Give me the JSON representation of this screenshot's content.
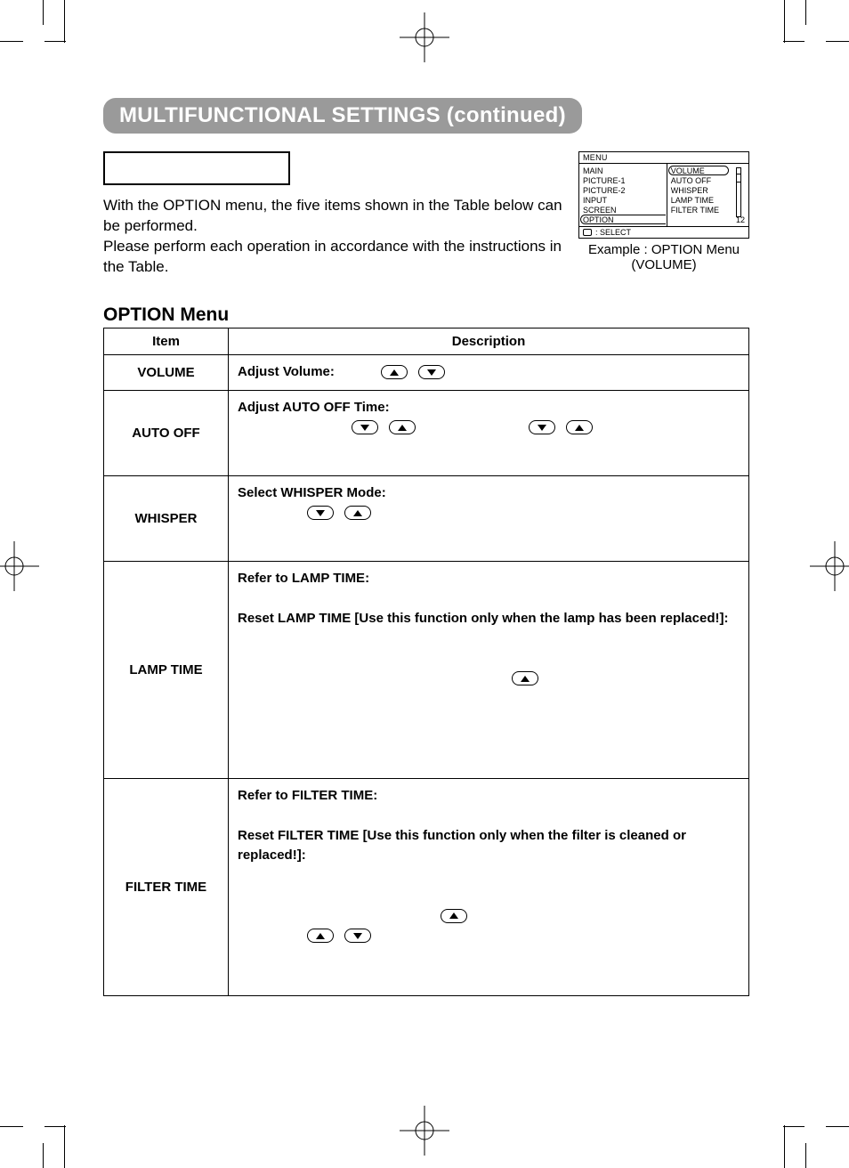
{
  "header": {
    "title": "MULTIFUNCTIONAL SETTINGS (continued)"
  },
  "intro": {
    "line1": "With the OPTION menu, the five items shown in the Table below can be performed.",
    "line2": "Please perform each operation in accordance with the instructions in the Table."
  },
  "osd": {
    "title": "MENU",
    "col1": [
      "MAIN",
      "PICTURE-1",
      "PICTURE-2",
      "INPUT",
      "SCREEN",
      "OPTION"
    ],
    "col2": [
      "VOLUME",
      "AUTO OFF",
      "WHISPER",
      "LAMP TIME",
      "FILTER TIME"
    ],
    "value": "12",
    "footer": ": SELECT",
    "caption1": "Example : OPTION Menu",
    "caption2": "(VOLUME)"
  },
  "section": {
    "heading": "OPTION Menu"
  },
  "table": {
    "headers": [
      "Item",
      "Description"
    ],
    "rows": [
      {
        "item": "VOLUME",
        "desc_title": "Adjust Volume:"
      },
      {
        "item": "AUTO OFF",
        "desc_title": "Adjust AUTO OFF Time:"
      },
      {
        "item": "WHISPER",
        "desc_title": "Select WHISPER Mode:"
      },
      {
        "item": "LAMP TIME",
        "desc_title": "Refer to LAMP TIME:",
        "desc_line2": "Reset LAMP TIME  [Use this function only when the lamp has been replaced!]:"
      },
      {
        "item": "FILTER TIME",
        "desc_title": "Refer to FILTER TIME:",
        "desc_line2": "Reset FILTER TIME [Use this function only when the filter is cleaned or replaced!]:"
      }
    ]
  }
}
